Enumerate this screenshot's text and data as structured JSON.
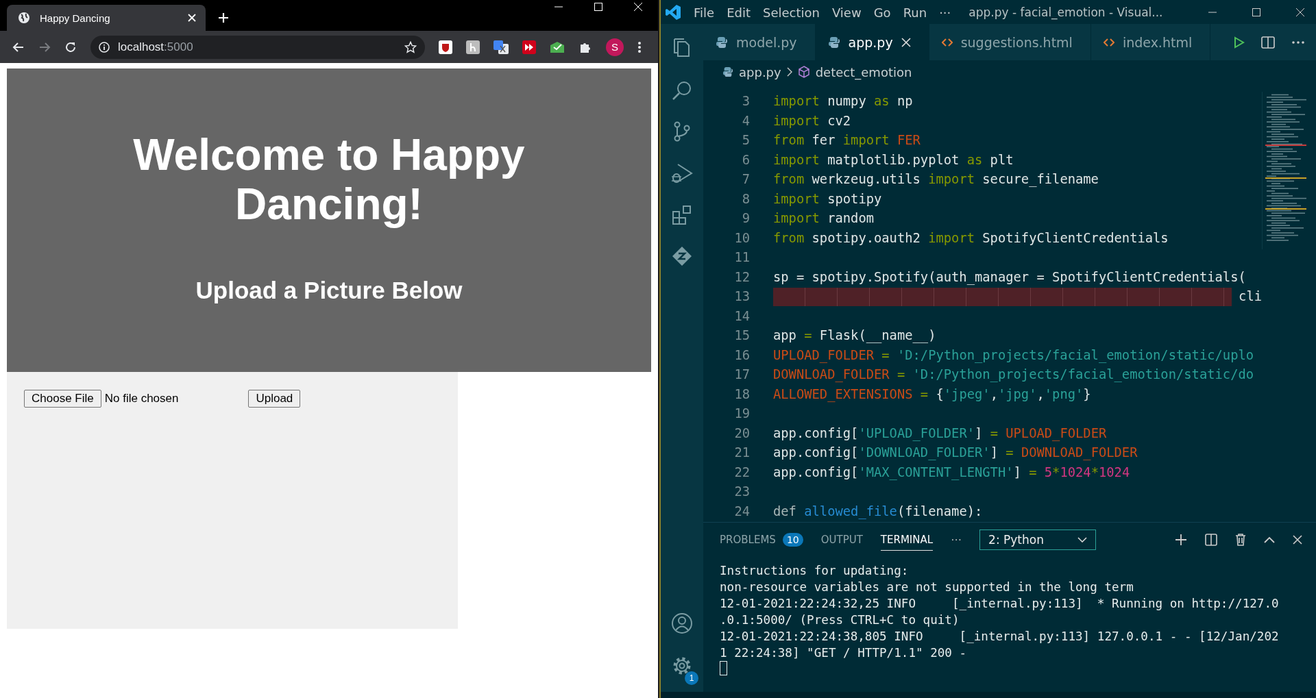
{
  "browser": {
    "tabs": [
      {
        "title": "Happy Dancing",
        "selected": true
      }
    ],
    "address": {
      "host": "localhost",
      "port": ":5000"
    },
    "profile_initial": "S",
    "page": {
      "heading": "Welcome to Happy Dancing!",
      "subheading": "Upload a Picture Below",
      "file_button": "Choose File",
      "file_status": "No file chosen",
      "upload_button": "Upload"
    }
  },
  "editor": {
    "menu": [
      "File",
      "Edit",
      "Selection",
      "View",
      "Go",
      "Run",
      "···"
    ],
    "title": "app.py - facial_emotion - Visual...",
    "tabs": [
      {
        "label": "model.py",
        "kind": "python",
        "selected": false
      },
      {
        "label": "app.py",
        "kind": "python",
        "selected": true
      },
      {
        "label": "suggestions.html",
        "kind": "html",
        "selected": false
      },
      {
        "label": "index.html",
        "kind": "html",
        "selected": false
      }
    ],
    "breadcrumb": {
      "file": "app.py",
      "symbol": "detect_emotion"
    },
    "code_lines": [
      {
        "number": "3",
        "tokens": [
          {
            "text": "import",
            "kind": "keyword"
          },
          {
            "text": " numpy ",
            "kind": "plain"
          },
          {
            "text": "as",
            "kind": "keyword"
          },
          {
            "text": " np",
            "kind": "plain"
          }
        ]
      },
      {
        "number": "4",
        "tokens": [
          {
            "text": "import",
            "kind": "keyword"
          },
          {
            "text": " cv2",
            "kind": "plain"
          }
        ]
      },
      {
        "number": "5",
        "tokens": [
          {
            "text": "from",
            "kind": "keyword"
          },
          {
            "text": " fer ",
            "kind": "plain"
          },
          {
            "text": "import ",
            "kind": "keyword"
          },
          {
            "text": "FER",
            "kind": "constant"
          }
        ]
      },
      {
        "number": "6",
        "tokens": [
          {
            "text": "import",
            "kind": "keyword"
          },
          {
            "text": " matplotlib.pyplot ",
            "kind": "plain"
          },
          {
            "text": "as",
            "kind": "keyword"
          },
          {
            "text": " plt",
            "kind": "plain"
          }
        ]
      },
      {
        "number": "7",
        "tokens": [
          {
            "text": "from",
            "kind": "keyword"
          },
          {
            "text": " werkzeug.utils ",
            "kind": "plain"
          },
          {
            "text": "import",
            "kind": "keyword"
          },
          {
            "text": " secure_filename",
            "kind": "plain"
          }
        ]
      },
      {
        "number": "8",
        "tokens": [
          {
            "text": "import",
            "kind": "keyword"
          },
          {
            "text": " spotipy",
            "kind": "plain"
          }
        ]
      },
      {
        "number": "9",
        "tokens": [
          {
            "text": "import",
            "kind": "keyword"
          },
          {
            "text": " random",
            "kind": "plain"
          }
        ]
      },
      {
        "number": "10",
        "tokens": [
          {
            "text": "from",
            "kind": "keyword"
          },
          {
            "text": " spotipy.oauth2 ",
            "kind": "plain"
          },
          {
            "text": "import",
            "kind": "keyword"
          },
          {
            "text": " SpotifyClientCredentials",
            "kind": "plain"
          }
        ]
      },
      {
        "number": "11"
      },
      {
        "number": "12",
        "tokens": [
          {
            "text": "sp = spotipy.Spotify(auth_manager = SpotifyClientCredentials(",
            "kind": "plain"
          }
        ]
      },
      {
        "number": "13",
        "redacted": true,
        "tokens": [
          {
            "text": "cli",
            "kind": "plain"
          }
        ]
      },
      {
        "number": "14"
      },
      {
        "number": "15",
        "tokens": [
          {
            "text": "app ",
            "kind": "plain"
          },
          {
            "text": "=",
            "kind": "keyword"
          },
          {
            "text": " Flask(__name__)",
            "kind": "plain"
          }
        ]
      },
      {
        "number": "16",
        "tokens": [
          {
            "text": "UPLOAD_FOLDER",
            "kind": "constant"
          },
          {
            "text": " = ",
            "kind": "keyword"
          },
          {
            "text": "'D:/Python_projects/facial_emotion/static/uplo",
            "kind": "string"
          }
        ]
      },
      {
        "number": "17",
        "tokens": [
          {
            "text": "DOWNLOAD_FOLDER",
            "kind": "constant"
          },
          {
            "text": " = ",
            "kind": "keyword"
          },
          {
            "text": "'D:/Python_projects/facial_emotion/static/do",
            "kind": "string"
          }
        ]
      },
      {
        "number": "18",
        "tokens": [
          {
            "text": "ALLOWED_EXTENSIONS",
            "kind": "constant"
          },
          {
            "text": " =",
            "kind": "keyword"
          },
          {
            "text": " {",
            "kind": "plain"
          },
          {
            "text": "'jpeg'",
            "kind": "string"
          },
          {
            "text": ",",
            "kind": "plain"
          },
          {
            "text": "'jpg'",
            "kind": "string"
          },
          {
            "text": ",",
            "kind": "plain"
          },
          {
            "text": "'png'",
            "kind": "string"
          },
          {
            "text": "}",
            "kind": "plain"
          }
        ]
      },
      {
        "number": "19"
      },
      {
        "number": "20",
        "tokens": [
          {
            "text": "app.config[",
            "kind": "plain"
          },
          {
            "text": "'UPLOAD_FOLDER'",
            "kind": "string"
          },
          {
            "text": "] ",
            "kind": "plain"
          },
          {
            "text": "= ",
            "kind": "keyword"
          },
          {
            "text": "UPLOAD_FOLDER",
            "kind": "constant"
          }
        ]
      },
      {
        "number": "21",
        "tokens": [
          {
            "text": "app.config[",
            "kind": "plain"
          },
          {
            "text": "'DOWNLOAD_FOLDER'",
            "kind": "string"
          },
          {
            "text": "] ",
            "kind": "plain"
          },
          {
            "text": "= ",
            "kind": "keyword"
          },
          {
            "text": "DOWNLOAD_FOLDER",
            "kind": "constant"
          }
        ]
      },
      {
        "number": "22",
        "tokens": [
          {
            "text": "app.config[",
            "kind": "plain"
          },
          {
            "text": "'MAX_CONTENT_LENGTH'",
            "kind": "string"
          },
          {
            "text": "] ",
            "kind": "plain"
          },
          {
            "text": "= ",
            "kind": "keyword"
          },
          {
            "text": "5",
            "kind": "number"
          },
          {
            "text": "*",
            "kind": "keyword"
          },
          {
            "text": "1024",
            "kind": "number"
          },
          {
            "text": "*",
            "kind": "keyword"
          },
          {
            "text": "1024",
            "kind": "number"
          }
        ]
      },
      {
        "number": "23"
      },
      {
        "number": "24",
        "tokens": [
          {
            "text": "def ",
            "kind": "storage"
          },
          {
            "text": "allowed_file",
            "kind": "function"
          },
          {
            "text": "(filename):",
            "kind": "plain"
          }
        ]
      }
    ],
    "panel": {
      "tabs": [
        {
          "label": "PROBLEMS",
          "badge": "10",
          "selected": false
        },
        {
          "label": "OUTPUT",
          "selected": false
        },
        {
          "label": "TERMINAL",
          "selected": true
        }
      ],
      "more": "···",
      "terminal_select": "2: Python",
      "terminal_lines": [
        "Instructions for updating:",
        "non-resource variables are not supported in the long term",
        "12-01-2021:22:24:32,25 INFO     [_internal.py:113]  * Running on http://127.0",
        ".0.1:5000/ (Press CTRL+C to quit)",
        "12-01-2021:22:24:38,805 INFO     [_internal.py:113] 127.0.0.1 - - [12/Jan/202",
        "1 22:24:38] \"GET / HTTP/1.1\" 200 -"
      ]
    },
    "settings_badge": "1"
  }
}
